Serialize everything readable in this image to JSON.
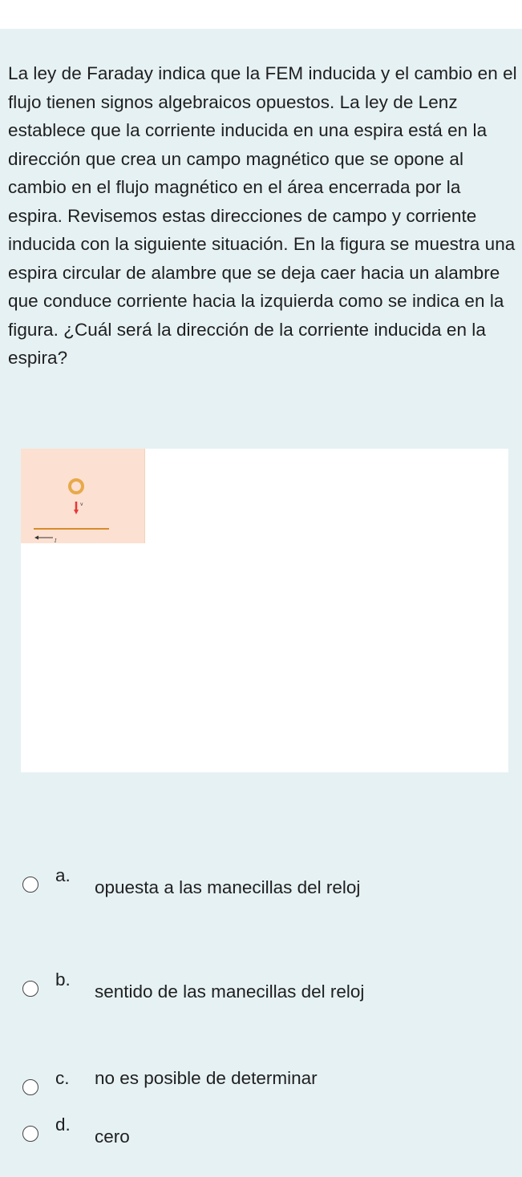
{
  "question": {
    "text": "La ley de Faraday indica que la FEM inducida y el cambio en el flujo tienen signos algebraicos opuestos. La ley de Lenz establece que la corriente inducida en una espira está en la dirección que crea un campo magnético que se opone al cambio en el flujo magnético en el área encerrada por la espira. Revisemos estas direcciones de campo y corriente inducida con la siguiente situación. En la figura se muestra una espira circular de alambre que se deja caer hacia un alambre que conduce corriente hacia la izquierda como se indica en la figura. ¿Cuál será la dirección de la corriente inducida en la espira?"
  },
  "figure": {
    "velocity_label": "v",
    "current_label": "I",
    "colors": {
      "ring": "#e8a94a",
      "arrow": "#e53935",
      "wire": "#d98a2b",
      "thumb_bg": "#fce0d2"
    }
  },
  "options": [
    {
      "letter": "a.",
      "text": "opuesta a las manecillas del reloj"
    },
    {
      "letter": "b.",
      "text": "sentido de las manecillas del reloj"
    },
    {
      "letter": "c.",
      "text": "no es posible de determinar"
    },
    {
      "letter": "d.",
      "text": "cero"
    }
  ]
}
